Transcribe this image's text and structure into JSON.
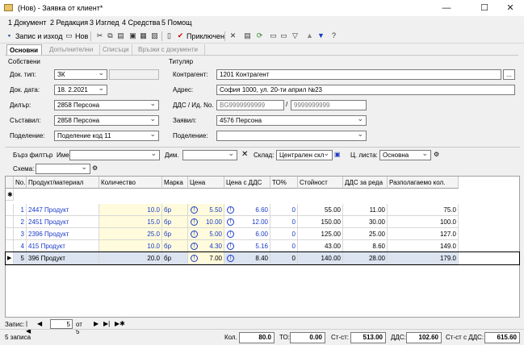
{
  "window": {
    "title": "(Нов) - Заявка от клиент*"
  },
  "menu": [
    "1 Документ",
    "2 Редакция",
    "3 Изглед",
    "4 Средства",
    "5 Помощ"
  ],
  "toolbar": {
    "save_exit": "Запис и изход",
    "new": "Нов",
    "post": "Приключен"
  },
  "tabs": [
    "Основни",
    "Допълнителни",
    "Списъци",
    "Връзки с документи"
  ],
  "owners": {
    "title": "Собствени",
    "doc_type_label": "Док. тип:",
    "doc_type": "ЗК",
    "doc_date_label": "Док. дата:",
    "doc_date": "18. 2.2021",
    "dealer_label": "Дилър:",
    "dealer": "2858 Персона",
    "compiler_label": "Съставил:",
    "compiler": "2858 Персона",
    "division_label": "Поделение:",
    "division": "Поделение код 11"
  },
  "holder": {
    "title": "Титуляр",
    "contragent_label": "Контрагент:",
    "contragent": "1201 Контрагент",
    "address_label": "Адрес:",
    "address": "София 1000, ул. 20-ти април №23",
    "vat_label": "ДДС / Ид. No.",
    "vat": "BG9999999999",
    "id": "9999999999",
    "requester_label": "Заявил:",
    "requester": "4576 Персона",
    "division_label": "Поделение:",
    "division": ""
  },
  "filter": {
    "quick_label": "Бърз филтър",
    "name_label": "Име:",
    "name": "",
    "dim_label": "Дим.",
    "dim": "",
    "warehouse_label": "Склад:",
    "warehouse": "Централен скл",
    "pricelist_label": "Ц. листа:",
    "pricelist": "Основна",
    "schema_label": "Схема:",
    "schema": ""
  },
  "grid": {
    "columns": [
      "No.",
      "Продукт/материал",
      "Количество",
      "Марка",
      "Цена",
      "Цена с ДДС",
      "ТО%",
      "Стойност",
      "ДДС за реда",
      "Разполагаемо кол."
    ],
    "rows": [
      [
        "1",
        "2447 Продукт",
        "10.0",
        "бр",
        "5.50",
        "6.60",
        "0",
        "55.00",
        "11.00",
        "75.0"
      ],
      [
        "2",
        "2451 Продукт",
        "15.0",
        "бр",
        "10.00",
        "12.00",
        "0",
        "150.00",
        "30.00",
        "100.0"
      ],
      [
        "3",
        "2396 Продукт",
        "25.0",
        "бр",
        "5.00",
        "6.00",
        "0",
        "125.00",
        "25.00",
        "127.0"
      ],
      [
        "4",
        "415 Продукт",
        "10.0",
        "бр",
        "4.30",
        "5.16",
        "0",
        "43.00",
        "8.60",
        "149.0"
      ],
      [
        "5",
        "396 Продукт",
        "20.0",
        "бр",
        "7.00",
        "8.40",
        "0",
        "140.00",
        "28.00",
        "179.0"
      ]
    ]
  },
  "navigator": {
    "label": "Запис:",
    "current": "5",
    "of": "от 5"
  },
  "status": {
    "records": "5 записа",
    "qty_label": "Кол.",
    "qty": "80.0",
    "to_label": "ТО:",
    "to": "0.00",
    "value_label": "Ст-ст:",
    "value": "513.00",
    "vat_label": "ДДС:",
    "vat": "102.60",
    "total_label": "Ст-ст с ДДС:",
    "total": "615.60"
  }
}
